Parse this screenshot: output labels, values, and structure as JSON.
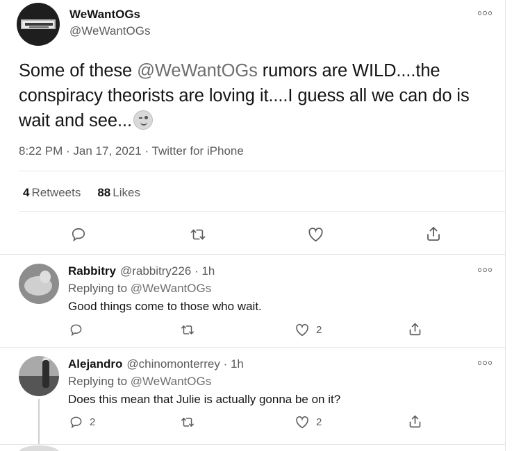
{
  "main_tweet": {
    "display_name": "WeWantOGs",
    "handle": "@WeWantOGs",
    "text_before": "Some of these ",
    "text_mention": "@WeWantOGs",
    "text_after": " rumors are WILD....the conspiracy theorists are loving it....I guess all we can do is wait and see...",
    "emoji": "winking-face",
    "timestamp": "8:22 PM · Jan 17, 2021",
    "source": "Twitter for iPhone",
    "retweets_count": "4",
    "retweets_label": "Retweets",
    "likes_count": "88",
    "likes_label": "Likes"
  },
  "replies": [
    {
      "display_name": "Rabbitry",
      "handle": "@rabbitry226",
      "time": "· 1h",
      "replying_prefix": "Replying to ",
      "replying_to": "@WeWantOGs",
      "text": "Good things come to those who wait.",
      "reply_count": "",
      "retweet_count": "",
      "like_count": "2"
    },
    {
      "display_name": "Alejandro",
      "handle": "@chinomonterrey",
      "time": "· 1h",
      "replying_prefix": "Replying to ",
      "replying_to": "@WeWantOGs",
      "text": "Does this mean that Julie is actually gonna be on it?",
      "reply_count": "2",
      "retweet_count": "",
      "like_count": "2"
    }
  ],
  "icons": {
    "reply": "reply-icon",
    "retweet": "retweet-icon",
    "like": "heart-icon",
    "share": "share-icon",
    "more": "more-options-icon"
  }
}
